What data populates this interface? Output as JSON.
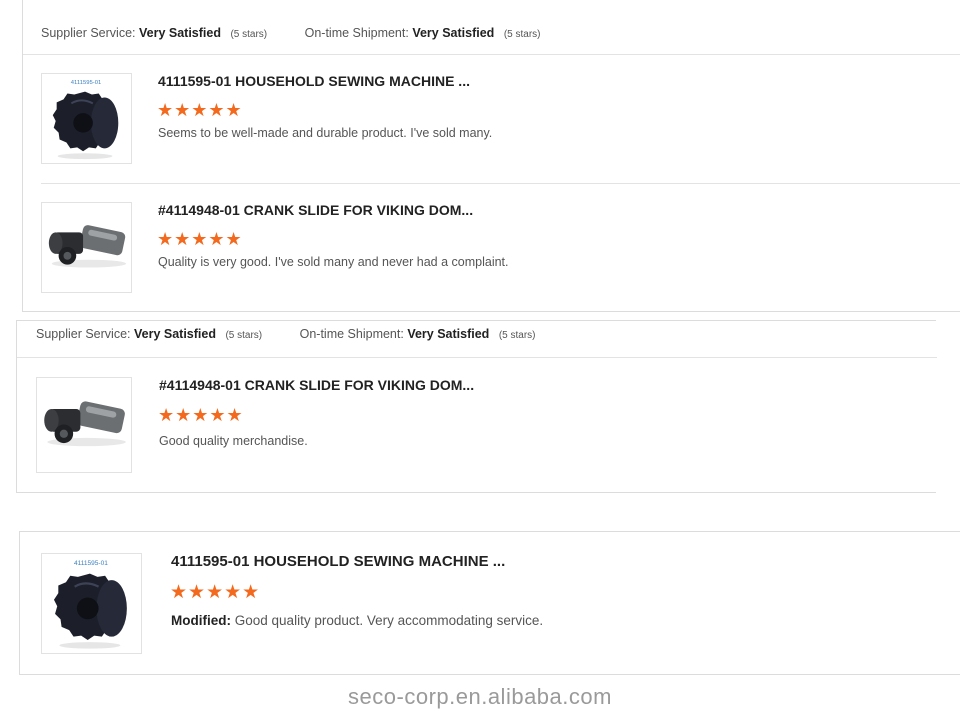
{
  "panel1": {
    "supplier_label": "Supplier Service:",
    "supplier_value": "Very Satisfied",
    "supplier_stars": "(5 stars)",
    "shipment_label": "On-time Shipment:",
    "shipment_value": "Very Satisfied",
    "shipment_stars": "(5 stars)",
    "items": [
      {
        "title": "4111595-01 HOUSEHOLD SEWING MACHINE ...",
        "stars": "★★★★★",
        "review": "Seems to be well-made and durable product. I've sold many.",
        "thumb_caption": "4111595-01",
        "thumb_icon": "knob-part-icon"
      },
      {
        "title": "#4114948-01 CRANK SLIDE FOR VIKING DOM...",
        "stars": "★★★★★",
        "review": "Quality is very good. I've sold many and never had a complaint.",
        "thumb_icon": "crank-slide-icon"
      }
    ]
  },
  "panel2": {
    "supplier_label": "Supplier Service:",
    "supplier_value": "Very Satisfied",
    "supplier_stars": "(5 stars)",
    "shipment_label": "On-time Shipment:",
    "shipment_value": "Very Satisfied",
    "shipment_stars": "(5 stars)",
    "item": {
      "title": "#4114948-01 CRANK SLIDE FOR VIKING DOM...",
      "stars": "★★★★★",
      "review": "Good quality merchandise.",
      "thumb_icon": "crank-slide-icon"
    }
  },
  "panel3": {
    "item": {
      "title": "4111595-01 HOUSEHOLD SEWING MACHINE ...",
      "stars": "★★★★★",
      "modified_label": "Modified:",
      "review": "Good quality product. Very accommodating service.",
      "thumb_caption": "4111595-01",
      "thumb_icon": "knob-part-icon"
    }
  },
  "watermark": "seco-corp.en.alibaba.com",
  "colors": {
    "star": "#f36a1e",
    "border": "#dcdcdc",
    "text": "#555555",
    "title": "#222222"
  }
}
